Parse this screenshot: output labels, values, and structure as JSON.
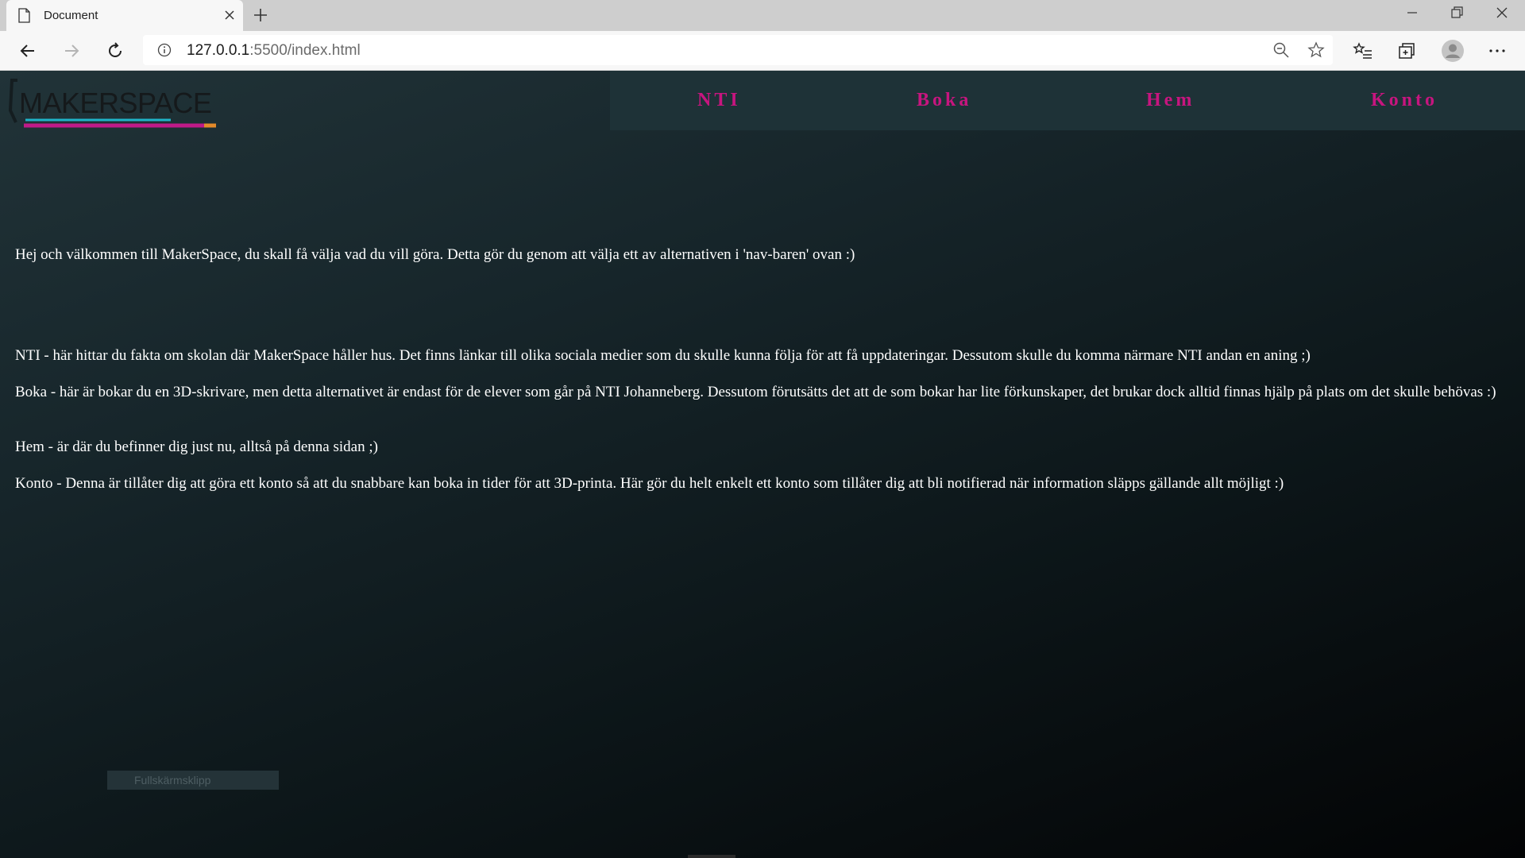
{
  "browser": {
    "tab_title": "Document",
    "url_host": "127.0.0.1",
    "url_path": ":5500/index.html"
  },
  "page": {
    "logo_text": "MAKERSPACE",
    "nav": [
      "NTI",
      "Boka",
      "Hem",
      "Konto"
    ],
    "intro": "Hej och välkommen till MakerSpace, du skall få välja vad du vill göra. Detta gör du genom att välja ett av alternativen i 'nav-baren' ovan :)",
    "items": [
      "NTI - här hittar du fakta om skolan där MakerSpace håller hus. Det finns länkar till olika sociala medier som du skulle kunna följa för att få uppdateringar. Dessutom skulle du komma närmare NTI andan en aning ;)",
      "Boka - här är bokar du en 3D-skrivare, men detta alternativet är endast för de elever som går på NTI Johanneberg. Dessutom förutsätts det att de som bokar har lite förkunskaper, det brukar dock alltid finnas hjälp på plats om det skulle behövas :)",
      "Hem - är där du befinner dig just nu, alltså på denna sidan ;)",
      "Konto - Denna är tillåter dig att göra ett konto så att du snabbare kan boka in tider för att 3D-printa. Här gör du helt enkelt ett konto som tillåter dig att bli notifierad när information släpps gällande allt möjligt :)"
    ],
    "snip_label": "Fullskärmsklipp"
  },
  "colors": {
    "nav_text": "#c7157f",
    "nav_bg": "#1e3237",
    "logo_cyan": "#1fb4c8",
    "logo_magenta": "#c01a88"
  }
}
